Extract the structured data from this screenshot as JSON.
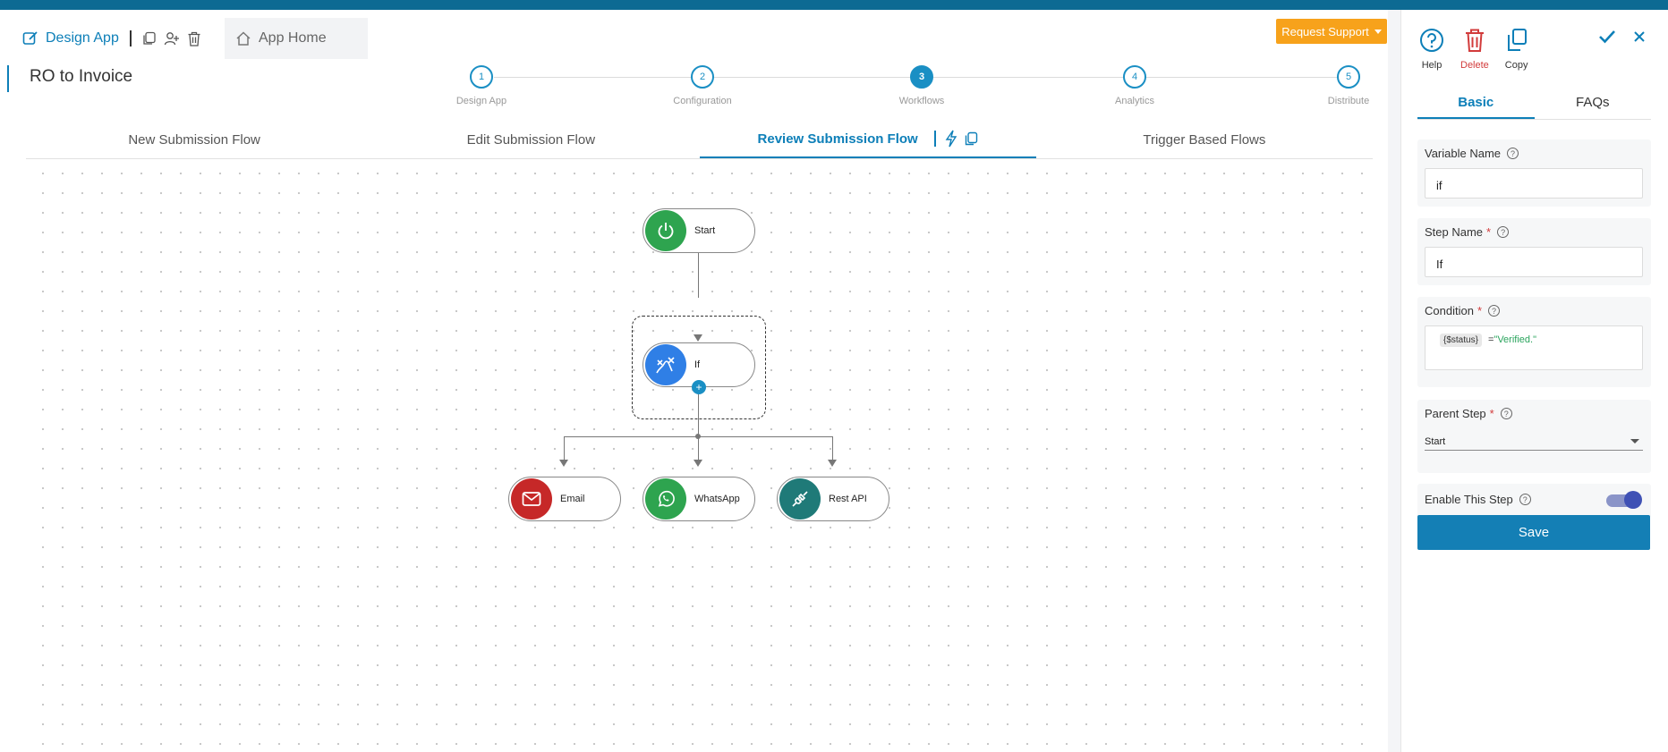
{
  "header": {
    "design_app_label": "Design App",
    "app_home_label": "App Home",
    "request_support_label": "Request Support",
    "page_title": "RO to Invoice"
  },
  "stepper": {
    "steps": [
      {
        "num": "1",
        "label": "Design App"
      },
      {
        "num": "2",
        "label": "Configuration"
      },
      {
        "num": "3",
        "label": "Workflows"
      },
      {
        "num": "4",
        "label": "Analytics"
      },
      {
        "num": "5",
        "label": "Distribute"
      }
    ],
    "active_step": "3"
  },
  "flow_tabs": [
    {
      "label": "New Submission Flow"
    },
    {
      "label": "Edit Submission Flow"
    },
    {
      "label": "Review Submission Flow"
    },
    {
      "label": "Trigger Based Flows"
    }
  ],
  "canvas": {
    "nodes": {
      "start": {
        "label": "Start",
        "icon": "power-icon",
        "color": "#2ea44f"
      },
      "if": {
        "label": "If",
        "icon": "branch-icon",
        "color": "#2f7fe6"
      },
      "email": {
        "label": "Email",
        "icon": "mail-icon",
        "color": "#c62828"
      },
      "whatsapp": {
        "label": "WhatsApp",
        "icon": "whatsapp-icon",
        "color": "#2ea44f"
      },
      "restapi": {
        "label": "Rest API",
        "icon": "plug-icon",
        "color": "#1f7a78"
      }
    }
  },
  "panel": {
    "actions": {
      "help": "Help",
      "delete": "Delete",
      "copy": "Copy"
    },
    "tabs": {
      "basic": "Basic",
      "faqs": "FAQs"
    },
    "variable_name": {
      "label": "Variable Name",
      "value": "if"
    },
    "step_name": {
      "label": "Step Name",
      "required": "*",
      "value": "If"
    },
    "condition": {
      "label": "Condition",
      "required": "*",
      "chip": "{$status}",
      "operator": "=",
      "value": "\"Verified.\""
    },
    "parent_step": {
      "label": "Parent Step",
      "required": "*",
      "value": "Start"
    },
    "enable_step": {
      "label": "Enable This Step",
      "enabled": true
    },
    "save_label": "Save"
  },
  "colors": {
    "accent": "#0d7fb8",
    "support": "#f7a21b",
    "danger": "#d23b3b"
  }
}
